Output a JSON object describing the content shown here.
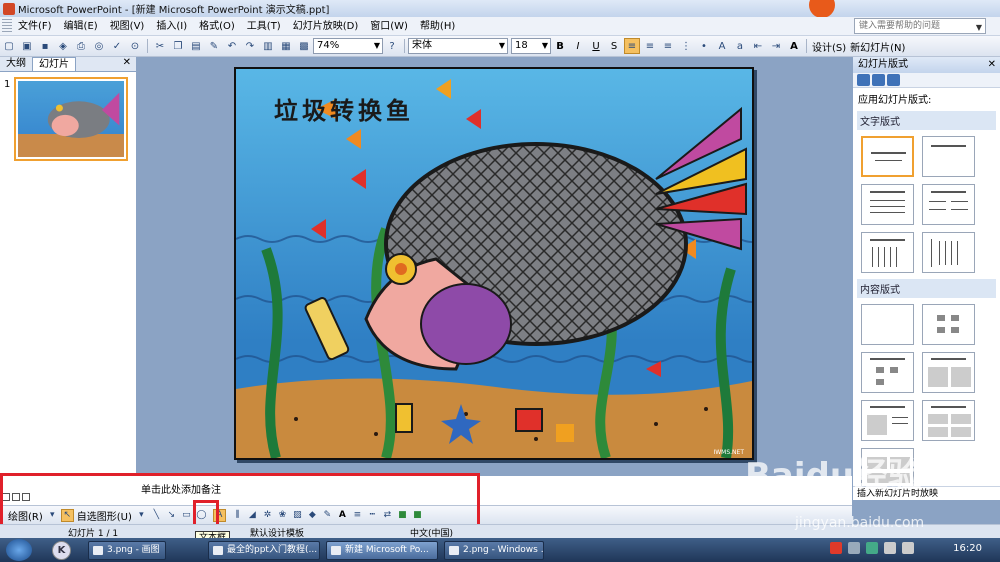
{
  "window": {
    "title": "Microsoft PowerPoint - [新建 Microsoft PowerPoint 演示文稿.ppt]"
  },
  "menu": {
    "items": [
      "文件(F)",
      "编辑(E)",
      "视图(V)",
      "插入(I)",
      "格式(O)",
      "工具(T)",
      "幻灯片放映(D)",
      "窗口(W)",
      "帮助(H)"
    ],
    "help_placeholder": "键入需要帮助的问题"
  },
  "toolbar": {
    "zoom": "74%",
    "font": "宋体",
    "font_size": "18",
    "bold": "B",
    "italic": "I",
    "underline": "U",
    "shadow": "S",
    "design_label": "设计(S)",
    "new_slide_label": "新幻灯片(N)"
  },
  "left_panel": {
    "tab_outline": "大纲",
    "tab_slides": "幻灯片",
    "slide_number": "1"
  },
  "slide": {
    "title": "垃圾转换鱼",
    "credit": "IWMS.NET"
  },
  "right_panel": {
    "header": "幻灯片版式",
    "apply_label": "应用幻灯片版式:",
    "section_text": "文字版式",
    "section_content": "内容版式",
    "footer": "插入新幻灯片时放映"
  },
  "notes": {
    "placeholder": "单击此处添加备注"
  },
  "drawing_toolbar": {
    "draw_label": "绘图(R)",
    "autoshapes_label": "自选图形(U)",
    "tooltip": "文本框"
  },
  "status": {
    "slide_info": "幻灯片 1 / 1",
    "template": "默认设计模板",
    "language": "中文(中国)"
  },
  "taskbar": {
    "quick_k": "K",
    "tasks": [
      "3.png - 画图",
      "最全的ppt入门教程(...",
      "新建 Microsoft Po...",
      "2.png - Windows ..."
    ],
    "clock": "16:20"
  },
  "watermark": {
    "brand": "Baidu经验",
    "url": "jingyan.baidu.com"
  },
  "colors": {
    "accent_orange": "#f0a030",
    "highlight_red": "#e0202a",
    "office_blue": "#8ba3c4"
  }
}
